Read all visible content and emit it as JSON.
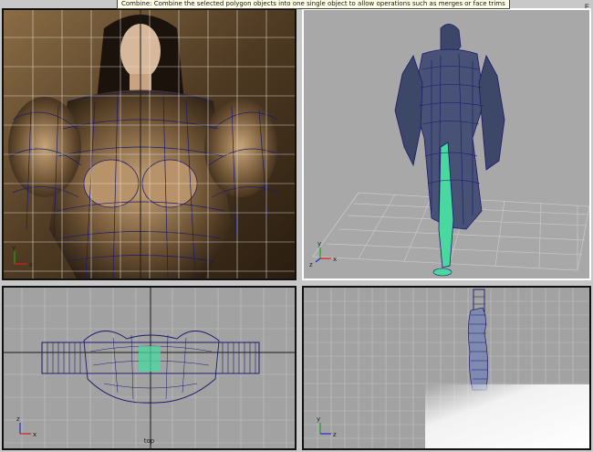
{
  "tooltip": {
    "text": "Combine: Combine the selected polygon objects into one single object to allow operations such as merges or face trims"
  },
  "window": {
    "corner_glyph": "E"
  },
  "viewports": [
    {
      "id": "front",
      "name": ""
    },
    {
      "id": "persp",
      "name": ""
    },
    {
      "id": "top",
      "name": "top"
    },
    {
      "id": "side",
      "name": ""
    }
  ],
  "axis": {
    "x": "x",
    "y": "y",
    "z": "z"
  },
  "colors": {
    "wireframe": "#1a1a6e",
    "grid_light": "#c8c8c8",
    "selected_mesh": "#48d8a0",
    "axis_x": "#d02020",
    "axis_y": "#20a020",
    "axis_z": "#2030d0"
  }
}
